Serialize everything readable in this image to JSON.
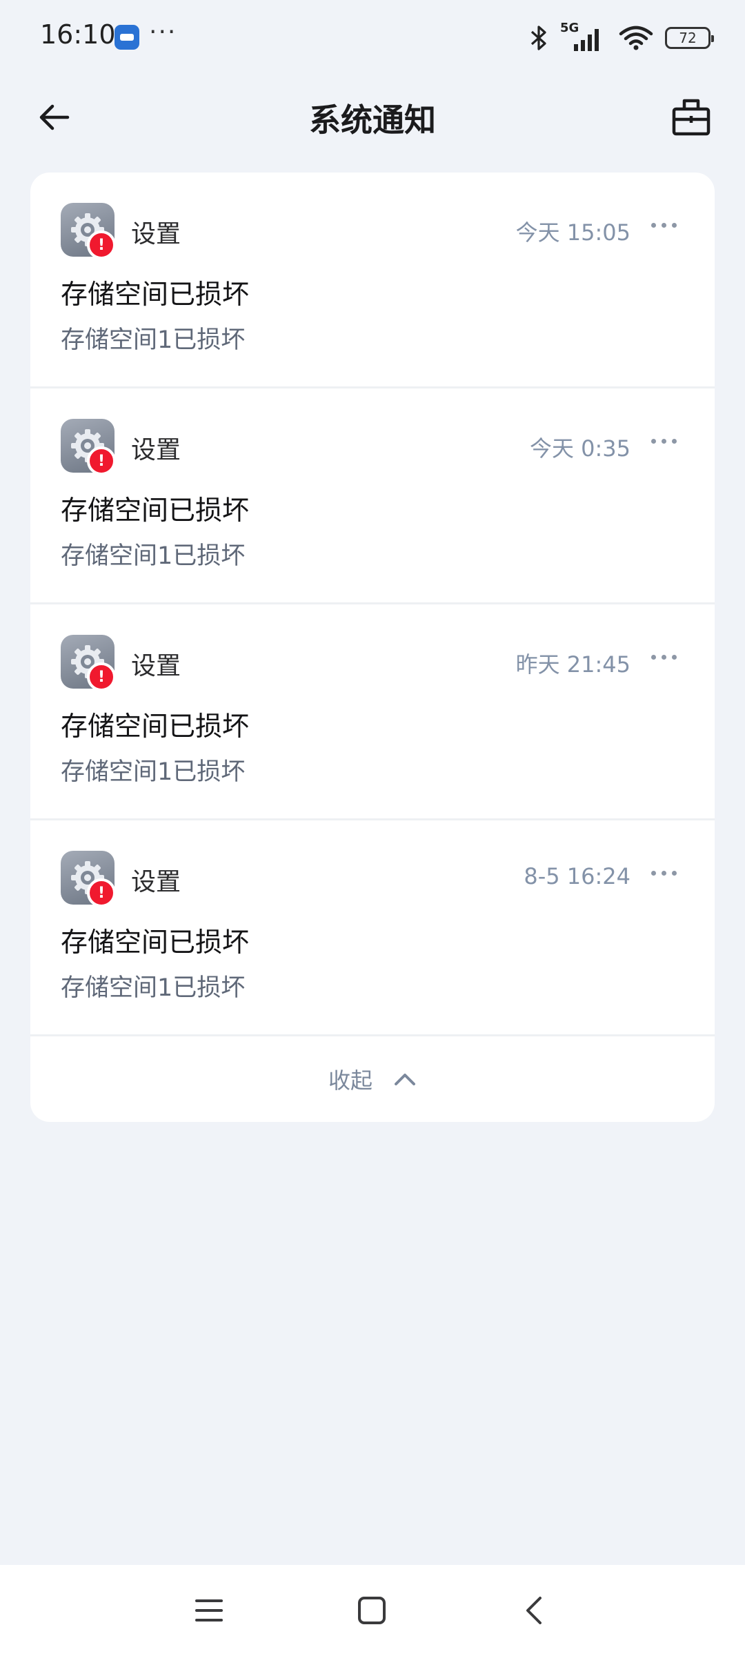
{
  "status_bar": {
    "time": "16:10",
    "network": "5G",
    "battery": "72",
    "icons": [
      "app-icon",
      "more-icon",
      "bluetooth-icon",
      "signal-icon",
      "wifi-icon",
      "battery-icon"
    ]
  },
  "header": {
    "title": "系统通知",
    "back_icon": "arrow-left-icon",
    "right_icon": "toolbox-icon"
  },
  "notifications": [
    {
      "app": "设置",
      "time": "今天 15:05",
      "title": "存储空间已损坏",
      "body": "存储空间1已损坏"
    },
    {
      "app": "设置",
      "time": "今天 0:35",
      "title": "存储空间已损坏",
      "body": "存储空间1已损坏"
    },
    {
      "app": "设置",
      "time": "昨天 21:45",
      "title": "存储空间已损坏",
      "body": "存储空间1已损坏"
    },
    {
      "app": "设置",
      "time": "8-5 16:24",
      "title": "存储空间已损坏",
      "body": "存储空间1已损坏"
    }
  ],
  "collapse": {
    "label": "收起",
    "icon": "chevron-up-icon"
  },
  "colors": {
    "background": "#f0f3f8",
    "card": "#ffffff",
    "badge": "#f0192e",
    "timestamp": "#8392a8"
  },
  "nav_bar": {
    "icons": [
      "menu-icon",
      "home-icon",
      "back-icon"
    ]
  }
}
